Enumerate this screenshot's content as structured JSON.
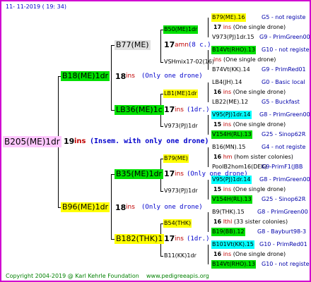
{
  "date": "11- 11-2019 ( 19: 34)",
  "footer": {
    "copyright": "Copyright 2004-2019 @ Karl Kehrle Foundation",
    "site": "www.pedigreeapis.org"
  },
  "colors": {
    "border": "#d000d0",
    "pink": "#ffc8ff",
    "green": "#00e000",
    "yellow": "#ffff00",
    "cyan": "#00ffff"
  },
  "root": {
    "label": "B205(ME)1dr",
    "year": "19",
    "ins": "ins",
    "note": "(Insem. with only one drone)"
  },
  "g1": [
    {
      "label": "B18(ME)1dr",
      "year": "18",
      "ins": "ins",
      "note": "(Only one drone)"
    },
    {
      "label": "B96(ME)1dr",
      "year": "18",
      "ins": "ins",
      "note": "(Only one drone)"
    }
  ],
  "g2": [
    {
      "label": "B77(ME)",
      "year": "17",
      "ins": "amn",
      "note": "(8 c.)"
    },
    {
      "label": "LB36(ME)1c",
      "year": "17",
      "ins": "ins",
      "note": "(1dr.)"
    },
    {
      "label": "B35(ME)1dr",
      "year": "17",
      "ins": "ins",
      "note": "(Only one drone)"
    },
    {
      "label": "B182(THK)1",
      "year": "17",
      "ins": "ins",
      "note": "(1dr.)"
    }
  ],
  "g3": [
    {
      "label": "B50(ME)1dr",
      "year": "17",
      "ins": "ins",
      "note": "(One single drone)"
    },
    {
      "label": "VSHmix17-02(16)",
      "year": "",
      "ins": "ins",
      "note": "(One single drone)"
    },
    {
      "label": "LB1(ME)1dr",
      "year": "16",
      "ins": "ins",
      "note": "(One single drone)"
    },
    {
      "label": "V973(PJ)1dr",
      "year": "15",
      "ins": "ins",
      "note": "(One single drone)"
    },
    {
      "label": "B79(ME)",
      "year": "16",
      "ins": "hm",
      "note": "(hom sister colonies)"
    },
    {
      "label": "V973(PJ)1dr",
      "year": "15",
      "ins": "ins",
      "note": "(One single drone)"
    },
    {
      "label": "B54(THK)",
      "year": "16",
      "ins": "lthl",
      "note": "(33 sister colonies)"
    },
    {
      "label": "B11(KK)1dr",
      "year": "16",
      "ins": "ins",
      "note": "(One single drone)"
    }
  ],
  "g4": [
    {
      "label": "B79(ME).16",
      "pos": "G5 - not registe"
    },
    {
      "label": "V973(PJ)1dr.15",
      "pos": "G9 - PrimGreen00"
    },
    {
      "label": "B14Vt(RHO).13",
      "pos": "G10 - not registe"
    },
    {
      "label": "B74Vt(KK).14",
      "pos": "G9 - PrimRed01"
    },
    {
      "label": "LB4(JH).14",
      "pos": "G0 - Basic local"
    },
    {
      "label": "LB22(ME).12",
      "pos": "G5 - Buckfast"
    },
    {
      "label": "V95(PJ)1dr.14",
      "pos": "G8 - PrimGreen00"
    },
    {
      "label": "V154H(RL).13",
      "pos": "G25 - Sinop62R"
    },
    {
      "label": "B16(MN).15",
      "pos": "G4 - not registe"
    },
    {
      "label": "PoolB2hom16(DEK)",
      "pos": "G9-PrimF1(JBB"
    },
    {
      "label": "V95(PJ)1dr.14",
      "pos": "G8 - PrimGreen00"
    },
    {
      "label": "V154H(RL).13",
      "pos": "G25 - Sinop62R"
    },
    {
      "label": "B9(THK).15",
      "pos": "G8 - PrimGreen00"
    },
    {
      "label": "B19(BB).12",
      "pos": "G8 - Bayburt98-3"
    },
    {
      "label": "B101Vt(KK).15",
      "pos": "G10 - PrimRed01"
    },
    {
      "label": "B14Vt(RHO).13",
      "pos": "G10 - not registe"
    }
  ]
}
